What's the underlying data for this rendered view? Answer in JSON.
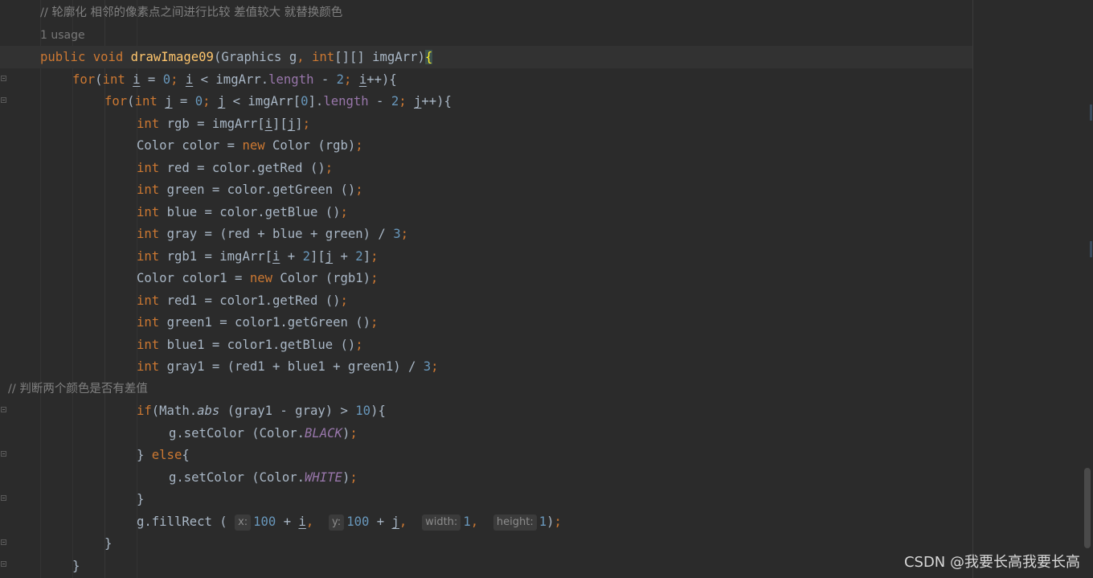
{
  "editor": {
    "comment_top": "// 轮廓化 相邻的像素点之间进行比较 差值较大 就替换颜色",
    "usage_hint": "1 usage",
    "comment_mid": "// 判断两个颜色是否有差值",
    "hints": {
      "x": "x:",
      "y": "y:",
      "width": "width:",
      "height": "height:"
    }
  },
  "watermark": "CSDN @我要长高我要长高",
  "colors": {
    "background": "#2b2b2b",
    "keyword": "#cc7832",
    "number": "#6897bb",
    "method": "#ffc66d",
    "field": "#9876aa",
    "comment": "#808080",
    "text": "#a9b7c6"
  }
}
